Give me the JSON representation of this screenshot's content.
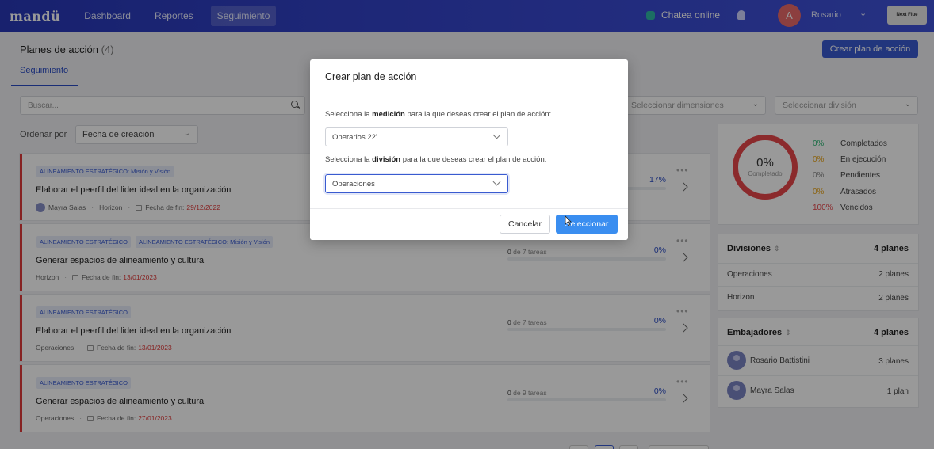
{
  "nav": {
    "logo": "mandü",
    "items": [
      "Dashboard",
      "Reportes",
      "Seguimiento"
    ],
    "chat_label": "Chatea online",
    "avatar_initial": "A",
    "user_name": "Rosario",
    "chevron": "⌄",
    "next_label": "Next Flue"
  },
  "header": {
    "title": "Planes de acción",
    "count": "(4)",
    "create_button": "Crear plan de acción",
    "tab": "Seguimiento"
  },
  "filters": {
    "search_placeholder": "Buscar...",
    "dimensions_placeholder": "Seleccionar dimensiones",
    "division_placeholder": "Seleccionar división",
    "order_label": "Ordenar por",
    "order_value": "Fecha de creación"
  },
  "plans": [
    {
      "tags": [
        "ALINEAMIENTO ESTRATÉGICO: Misión y Visión"
      ],
      "title": "Elaborar el peerfil del lider ideal en la organización",
      "owner": "Mayra Salas",
      "division": "Horizon",
      "due_label": "Fecha de fin:",
      "due_date": "29/12/2022",
      "tasks": "",
      "pct": "17%"
    },
    {
      "tags": [
        "ALINEAMIENTO ESTRATÉGICO",
        "ALINEAMIENTO ESTRATÉGICO: Misión y Visión"
      ],
      "title": "Generar espacios de alineamiento y cultura",
      "division": "Horizon",
      "due_label": "Fecha de fin:",
      "due_date": "13/01/2023",
      "tasks_done": "0",
      "tasks_rest": "de 7 tareas",
      "pct": "0%"
    },
    {
      "tags": [
        "ALINEAMIENTO ESTRATÉGICO"
      ],
      "title": "Elaborar el peerfil del lider ideal en la organización",
      "division": "Operaciones",
      "due_label": "Fecha de fin:",
      "due_date": "13/01/2023",
      "tasks_done": "0",
      "tasks_rest": "de 7 tareas",
      "pct": "0%"
    },
    {
      "tags": [
        "ALINEAMIENTO ESTRATÉGICO"
      ],
      "title": "Generar espacios de alineamiento y cultura",
      "division": "Operaciones",
      "due_label": "Fecha de fin:",
      "due_date": "27/01/2023",
      "tasks_done": "0",
      "tasks_rest": "de 9 tareas",
      "pct": "0%"
    }
  ],
  "summary": {
    "donut_pct": "0%",
    "donut_label": "Completado",
    "donut_color": "#e8464a",
    "stats": [
      {
        "pct": "0%",
        "label": "Completados",
        "color": "#2bb673"
      },
      {
        "pct": "0%",
        "label": "En ejecución",
        "color": "#e8a317"
      },
      {
        "pct": "0%",
        "label": "Pendientes",
        "color": "#888888"
      },
      {
        "pct": "0%",
        "label": "Atrasados",
        "color": "#e8a317"
      },
      {
        "pct": "100%",
        "label": "Vencidos",
        "color": "#e8464a"
      }
    ]
  },
  "divisions": {
    "title": "Divisiones",
    "total": "4 planes",
    "rows": [
      {
        "name": "Operaciones",
        "count": "2 planes"
      },
      {
        "name": "Horizon",
        "count": "2 planes"
      }
    ]
  },
  "ambassadors": {
    "title": "Embajadores",
    "total": "4 planes",
    "rows": [
      {
        "name": "Rosario Battistini",
        "count": "3 planes"
      },
      {
        "name": "Mayra Salas",
        "count": "1 plan"
      }
    ]
  },
  "modal": {
    "title": "Crear plan de acción",
    "label1_pre": "Selecciona la",
    "label1_bold": "medición",
    "label1_post": "para la que deseas crear el plan de acción:",
    "measure_value": "Operarios 22'",
    "label2_pre": "Selecciona la",
    "label2_bold": "división",
    "label2_post": "para la que deseas crear el plan de acción:",
    "division_value": "Operaciones",
    "cancel_label": "Cancelar",
    "select_label": "Seleccionar"
  },
  "colors": {
    "accent": "#3a5bd0",
    "primary_button": "#3a8ef0",
    "danger": "#e03a3a"
  }
}
